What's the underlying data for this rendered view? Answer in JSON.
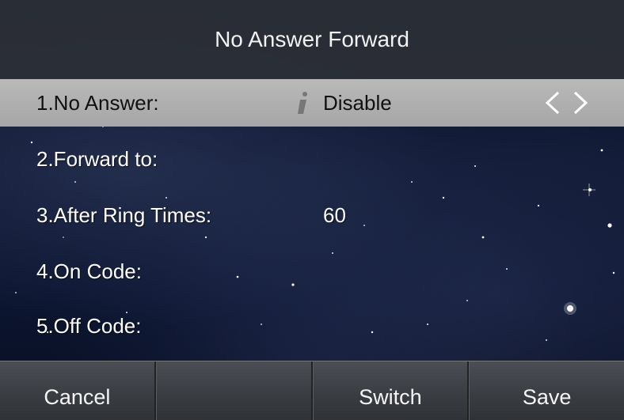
{
  "header": {
    "title": "No Answer Forward"
  },
  "menu": {
    "items": [
      {
        "label": "1.No Answer:",
        "value": "Disable",
        "selected": true
      },
      {
        "label": "2.Forward to:",
        "value": ""
      },
      {
        "label": "3.After Ring Times:",
        "value": "60"
      },
      {
        "label": "4.On Code:",
        "value": ""
      },
      {
        "label": "5.Off Code:",
        "value": ""
      }
    ],
    "selected_icons": [
      "info-icon",
      "chevron-left-icon",
      "chevron-right-icon"
    ]
  },
  "softkeys": {
    "key1": "Cancel",
    "key2": "",
    "key3": "Switch",
    "key4": "Save"
  },
  "colors": {
    "title_bar": "#2d3037",
    "selected_row": "#b0b0b0",
    "softkey_bar": "#3a3d42",
    "text": "#ffffff"
  }
}
